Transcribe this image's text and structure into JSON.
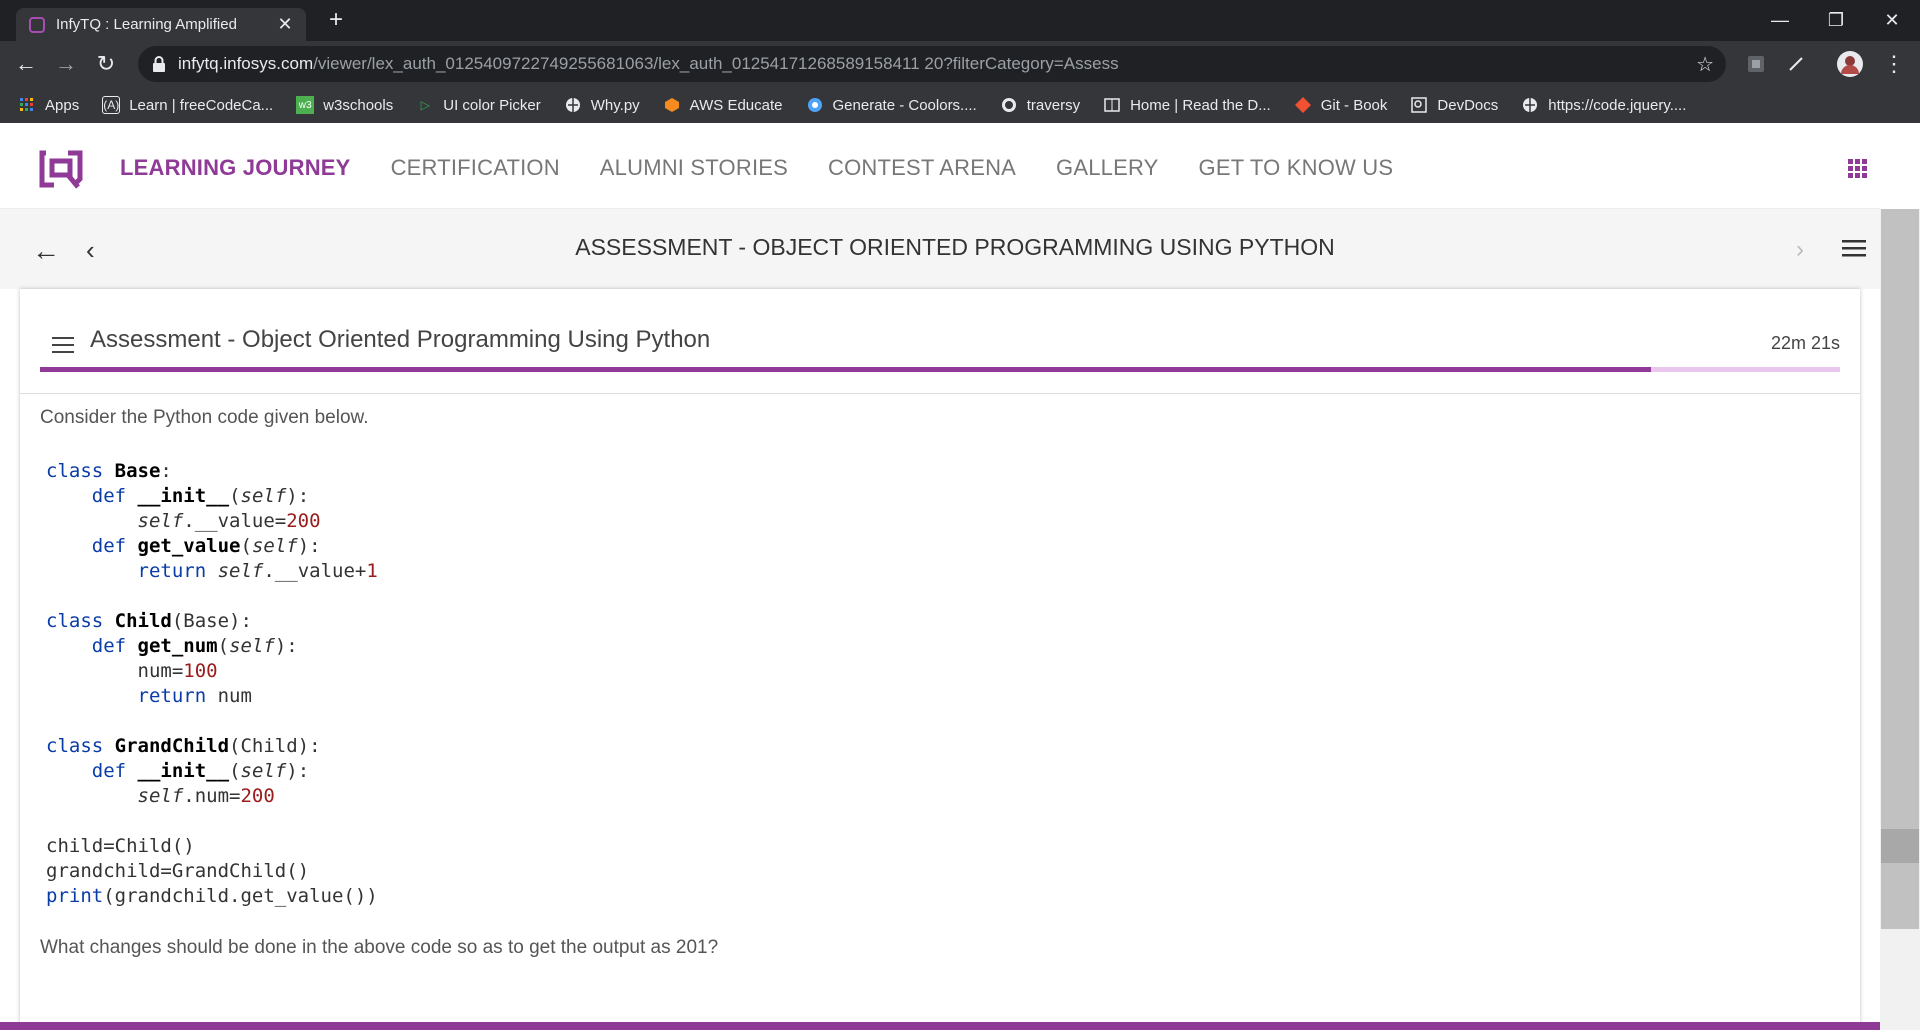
{
  "browser": {
    "tab_title": "InfyTQ : Learning Amplified",
    "url_host": "infytq.infosys.com",
    "url_path": "/viewer/lex_auth_012540972274925568​1063/lex_auth_01254171268589158411 20?filterCategory=Assess",
    "bookmarks": [
      {
        "label": "Apps",
        "icon": "apps-grid-icon"
      },
      {
        "label": "Learn | freeCodeCa...",
        "icon": "freecodecamp-icon"
      },
      {
        "label": "w3schools",
        "icon": "w3schools-icon"
      },
      {
        "label": "UI color Picker",
        "icon": "play-icon"
      },
      {
        "label": "Why.py",
        "icon": "globe-icon"
      },
      {
        "label": "AWS Educate",
        "icon": "aws-icon"
      },
      {
        "label": "Generate - Coolors....",
        "icon": "coolors-icon"
      },
      {
        "label": "traversy",
        "icon": "github-icon"
      },
      {
        "label": "Home | Read the D...",
        "icon": "readthedocs-icon"
      },
      {
        "label": "Git - Book",
        "icon": "git-icon"
      },
      {
        "label": "DevDocs",
        "icon": "devdocs-icon"
      },
      {
        "label": "https://code.jquery....",
        "icon": "globe-icon"
      }
    ]
  },
  "site": {
    "nav": [
      {
        "label": "LEARNING JOURNEY",
        "active": true
      },
      {
        "label": "CERTIFICATION",
        "active": false
      },
      {
        "label": "ALUMNI STORIES",
        "active": false
      },
      {
        "label": "CONTEST ARENA",
        "active": false
      },
      {
        "label": "GALLERY",
        "active": false
      },
      {
        "label": "GET TO KNOW US",
        "active": false
      }
    ],
    "header_title": "ASSESSMENT - OBJECT ORIENTED PROGRAMMING USING PYTHON"
  },
  "assessment": {
    "title": "Assessment - Object Oriented Programming Using Python",
    "timer": "22m 21s",
    "progress": 0.895,
    "intro": "Consider the Python code given below.",
    "question": "What changes should be done in the above code so as to get the output as 201?"
  },
  "colors": {
    "accent": "#8e3a96",
    "keyword": "#0a3ca8",
    "number": "#9b1c1c"
  }
}
